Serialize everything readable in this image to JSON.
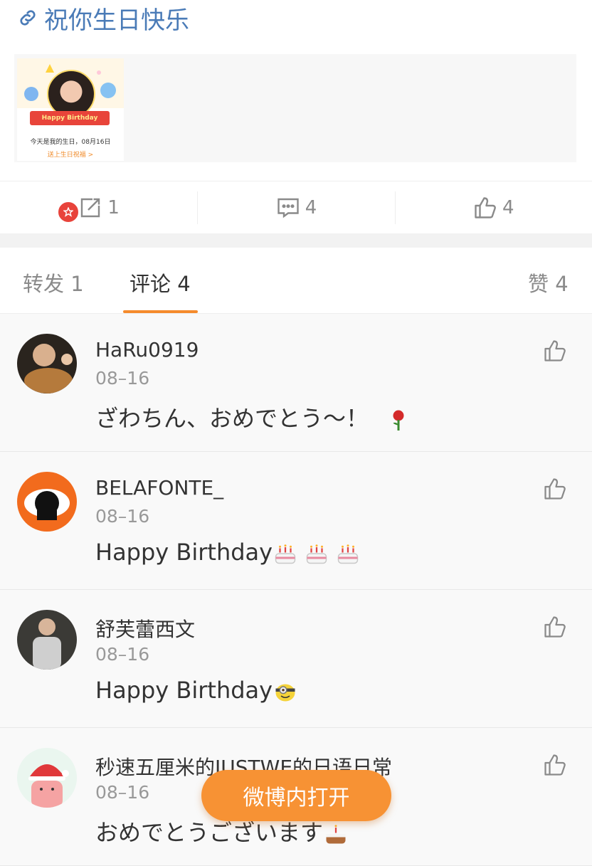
{
  "post": {
    "link_title": "祝你生日快乐",
    "card": {
      "banner": "Happy Birthday",
      "text": "今天是我的生日，08月16日",
      "link": "送上生日祝福 >"
    }
  },
  "actions": {
    "repost": {
      "icon": "edit-square-icon",
      "count": "1"
    },
    "comment": {
      "icon": "comment-icon",
      "count": "4"
    },
    "like": {
      "icon": "thumbs-up-icon",
      "count": "4"
    }
  },
  "tabs": {
    "repost": "转发 1",
    "comments": "评论 4",
    "likes": "赞 4"
  },
  "comments": [
    {
      "name": "HaRu0919",
      "time": "08–16",
      "text": "ざわちん、おめでとう～！",
      "emoji": "rose-emoji"
    },
    {
      "name": "BELAFONTE_",
      "time": "08–16",
      "text": "Happy Birthday",
      "emoji": "cake-emoji x3"
    },
    {
      "name": "舒芙蕾西文",
      "time": "08–16",
      "text": "Happy Birthday",
      "emoji": "minion-emoji"
    },
    {
      "name": "秒速五厘米的JUSTWE的日语日常",
      "time": "08–16",
      "text": "おめでとうございます",
      "emoji": "cake-emoji"
    }
  ],
  "open_button": "微博内打开",
  "colors": {
    "accent": "#f58b2c",
    "link": "#4a7bb7"
  }
}
